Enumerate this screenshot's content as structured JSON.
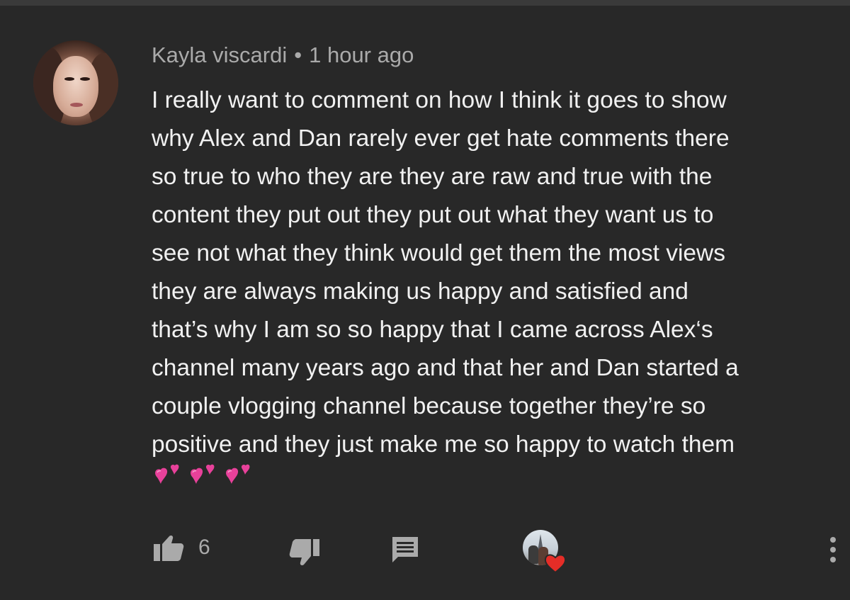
{
  "comment": {
    "author": "Kayla viscardi",
    "separator": "•",
    "timestamp": "1 hour ago",
    "lines": [
      "I really want to comment on how I think it goes to show",
      "why Alex and Dan rarely ever get hate comments there",
      "so true to who they are they are raw and true with the",
      "content they put out they put out what they want us to",
      "see not what they think would get them the most views",
      "they are always making us happy and satisfied and",
      "that’s why I am so so happy that I came across Alex‘s",
      "channel many years ago and that her and Dan started a",
      "couple vlogging channel because together they’re so",
      "positive and they just make me so happy to watch them"
    ],
    "emoji": [
      "two-hearts",
      "two-hearts",
      "two-hearts"
    ]
  },
  "actions": {
    "like_icon": "thumbs-up-icon",
    "like_count": "6",
    "dislike_icon": "thumbs-down-icon",
    "reply_icon": "reply-icon",
    "creator_heart_icon": "red-heart-icon",
    "more_icon": "more-vert-icon"
  },
  "colors": {
    "background": "#282828",
    "text_primary": "#f1f1f1",
    "text_secondary": "#aaaaaa",
    "heart_pink": "#e8419a",
    "heart_red": "#e52d27"
  }
}
